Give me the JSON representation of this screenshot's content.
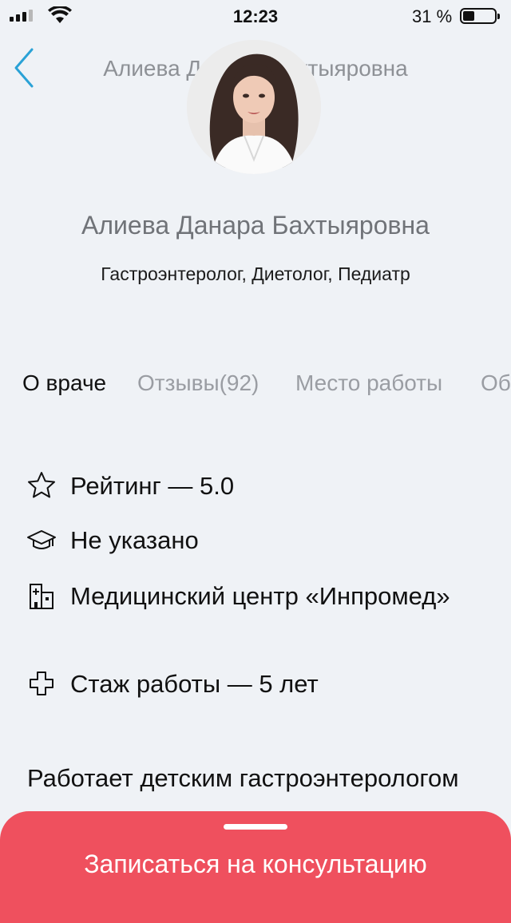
{
  "status": {
    "time": "12:23",
    "battery_percent": "31 %",
    "battery_level": 0.31
  },
  "nav": {
    "title": "Алиева Данара Бахтыяровна",
    "back_icon": "chevron-left-icon"
  },
  "doctor": {
    "name": "Алиева Данара Бахтыяровна",
    "specialties": "Гастроэнтеролог, Диетолог, Педиатр"
  },
  "tabs": [
    {
      "label": "О враче",
      "active": true
    },
    {
      "label": "Отзывы(92)",
      "active": false
    },
    {
      "label": "Место работы",
      "active": false
    },
    {
      "label": "Об",
      "active": false
    }
  ],
  "info": [
    {
      "icon": "star-icon",
      "text": "Рейтинг — 5.0"
    },
    {
      "icon": "graduation-cap-icon",
      "text": "Не указано"
    },
    {
      "icon": "hospital-building-icon",
      "text": "Медицинский центр «Инпромед»"
    },
    {
      "icon": "medical-cross-icon",
      "text": "Стаж работы — 5 лет"
    }
  ],
  "description": "Работает детским гастроэнтерологом",
  "cta": {
    "label": "Записаться на консультацию"
  },
  "colors": {
    "accent": "#ef505e",
    "link": "#2aa2d6",
    "background": "#eff2f6"
  }
}
